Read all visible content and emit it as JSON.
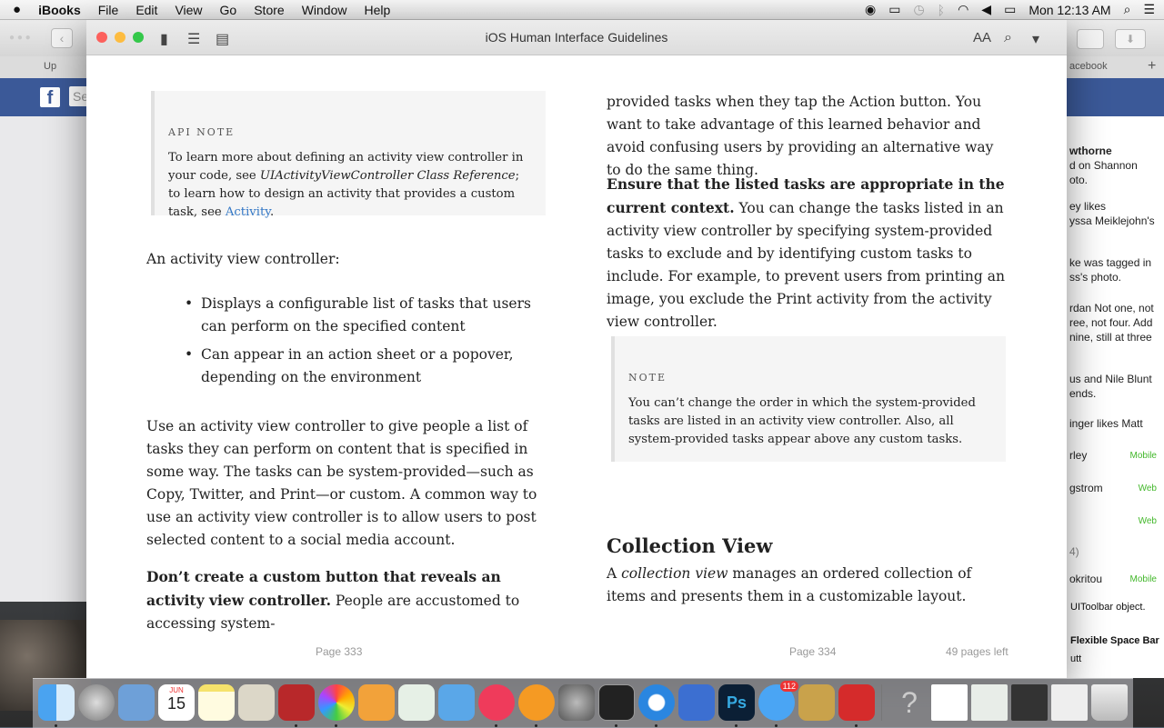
{
  "menubar": {
    "apple": "",
    "app_name": "iBooks",
    "menus": [
      "File",
      "Edit",
      "View",
      "Go",
      "Store",
      "Window",
      "Help"
    ],
    "clock": "Mon 12:13 AM"
  },
  "background_window": {
    "tab_left": "Up",
    "tab_right": "acebook",
    "search_placeholder": "Se",
    "feed": [
      {
        "text": "wthorne",
        "bold": true
      },
      {
        "text": "d on Shannon"
      },
      {
        "text": "oto."
      },
      {
        "text": "ey likes",
        "bold_prefix": "ey"
      },
      {
        "text": "yssa Meiklejohn's"
      },
      {
        "text": "ke was tagged in"
      },
      {
        "text": "ss's photo."
      },
      {
        "text": "rdan Not one, not"
      },
      {
        "text": "ree, not four. Add"
      },
      {
        "text": "nine, still at three"
      },
      {
        "text": "us and Nile Blunt"
      },
      {
        "text": "ends."
      },
      {
        "text": "inger likes Matt"
      }
    ],
    "chat": [
      {
        "name": "rley",
        "status": "Mobile"
      },
      {
        "name": "gstrom",
        "status": "Web"
      },
      {
        "name": "",
        "status": "Web"
      },
      {
        "name": "4)",
        "status": ""
      },
      {
        "name": "okritou",
        "status": "Mobile"
      }
    ],
    "lower_text": [
      "UIToolbar object.",
      "Flexible Space Bar",
      "utt"
    ]
  },
  "window": {
    "title": "iOS Human Interface Guidelines",
    "font_size_label": "AA"
  },
  "left_page": {
    "api_note_head": "API NOTE",
    "api_note_text_1": "To learn more about defining an activity view controller in your code, see ",
    "api_note_italic": "UIActivityViewController Class Reference",
    "api_note_text_2": "; to learn how to design an activity that provides a custom task, see ",
    "api_note_link": "Activity",
    "api_note_text_3": ".",
    "intro": "An activity view controller:",
    "bullets": [
      "Displays a configurable list of tasks that users can perform on the specified content",
      "Can appear in an action sheet or a popover, depending on the environment"
    ],
    "para1": "Use an activity view controller to give people a list of tasks they can perform on content that is specified in some way. The tasks can be system-provided—such as Copy, Twitter, and Print—or custom. A common way to use an activity view controller is to allow users to post selected content to a social media account.",
    "para2_bold": "Don’t create a custom button that reveals an activity view controller.",
    "para2_rest": " People are accustomed to accessing system-",
    "page_number": "Page 333"
  },
  "right_page": {
    "para1": "provided tasks when they tap the Action button. You want to take advantage of this learned behavior and avoid confusing users by providing an alternative way to do the same thing.",
    "para2_bold": "Ensure that the listed tasks are appropriate in the current context.",
    "para2_rest": " You can change the tasks listed in an activity view controller by specifying system-provided tasks to exclude and by identifying custom tasks to include. For example, to prevent users from printing an image, you exclude the Print activity from the activity view controller.",
    "note_head": "NOTE",
    "note_text": "You can’t change the order in which the system-provided tasks are listed in an activity view controller. Also, all system-provided tasks appear above any custom tasks.",
    "section_title": "Collection View",
    "section_text_1": "A ",
    "section_italic": "collection view",
    "section_text_2": " manages an ordered collection of items and presents them in a customizable layout.",
    "page_number": "Page 334",
    "pages_left": "49 pages left"
  },
  "dock": {
    "calendar_month": "JUN",
    "calendar_day": "15",
    "messages_badge": "112",
    "help_glyph": "?"
  },
  "colors": {
    "accent_link": "#3478c6",
    "facebook_blue": "#3b5998",
    "close": "#fc605c",
    "minimize": "#fdbc40",
    "zoom": "#34c84a"
  }
}
